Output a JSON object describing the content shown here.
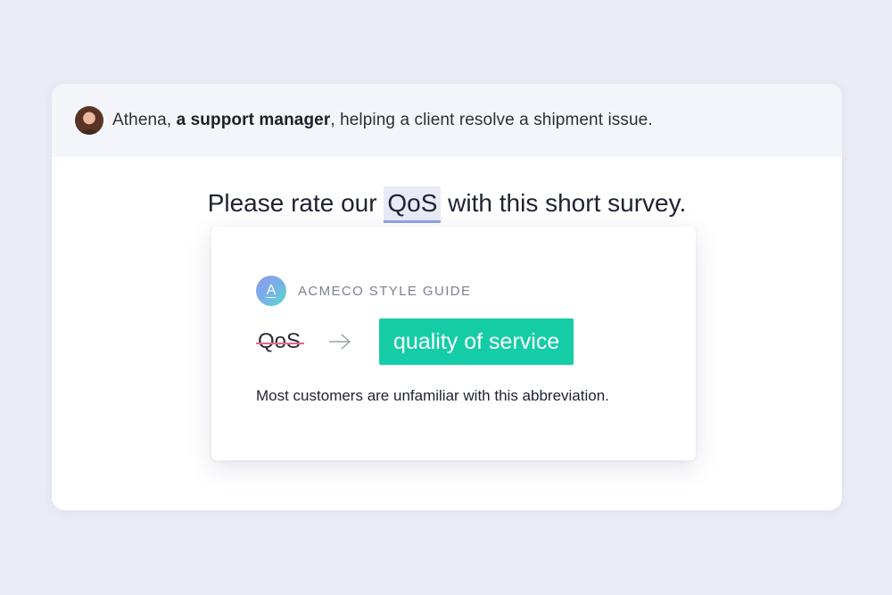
{
  "header": {
    "name": "Athena",
    "role": "a support manager",
    "context": ", helping a client resolve a shipment issue."
  },
  "sentence": {
    "before": "Please rate our ",
    "highlight": "QoS",
    "after": " with this short survey."
  },
  "suggestion_card": {
    "logo_letter": "A",
    "guide_title": "ACMECO STYLE GUIDE",
    "original": "QoS",
    "replacement": "quality of service",
    "explanation": "Most customers are unfamiliar with this abbreviation."
  },
  "icons": {
    "avatar": "user-avatar-photo",
    "arrow": "arrow-right-icon",
    "logo": "style-guide-logo-icon"
  },
  "colors": {
    "background": "#e9ebf6",
    "highlight_bg": "#e8ebf6",
    "highlight_underline": "#8fa3e2",
    "suggestion_bg": "#14cda7",
    "strike": "#e36a86"
  }
}
